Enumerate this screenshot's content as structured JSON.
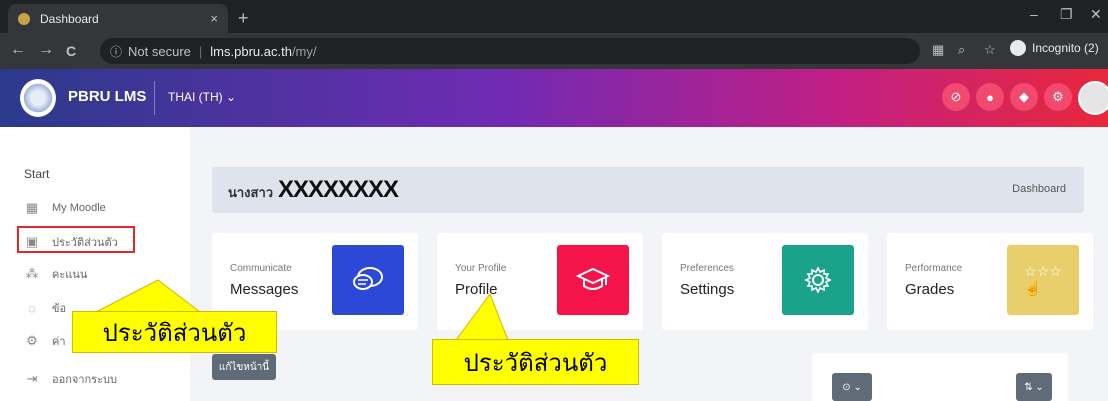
{
  "browser": {
    "tab_title": "Dashboard",
    "tab_close": "×",
    "new_tab": "+",
    "win_min": "–",
    "win_max": "❐",
    "win_close": "✕",
    "back": "←",
    "forward": "→",
    "reload": "C",
    "security_label": "Not secure",
    "url_host": "lms.pbru.ac.th",
    "url_path": "/my/",
    "incognito_label": "Incognito (2)"
  },
  "header": {
    "brand": "PBRU LMS",
    "language": "THAI (TH) ⌄",
    "colors": {
      "accent": "#f24a6e"
    }
  },
  "sidebar": {
    "start": "Start",
    "items": [
      {
        "label": "My Moodle",
        "icon": "dashboard-icon"
      },
      {
        "label": "ประวัติส่วนตัว",
        "icon": "profile-icon"
      },
      {
        "label": "คะแนน",
        "icon": "grades-icon"
      },
      {
        "label": "ข้อ",
        "icon": "messages-icon"
      },
      {
        "label": "ค่า",
        "icon": "settings-icon"
      },
      {
        "label": "ออกจากระบบ",
        "icon": "logout-icon"
      }
    ]
  },
  "page_header": {
    "name": "นางสาว",
    "redacted": "XXXXXXXX",
    "breadcrumb": "Dashboard"
  },
  "cards": [
    {
      "subtitle": "Communicate",
      "title": "Messages",
      "icon": "chat-icon",
      "color": "#2b48d6"
    },
    {
      "subtitle": "Your Profile",
      "title": "Profile",
      "icon": "graduation-cap-icon",
      "color": "#f5144a"
    },
    {
      "subtitle": "Preferences",
      "title": "Settings",
      "icon": "gear-icon",
      "color": "#1aa38a"
    },
    {
      "subtitle": "Performance",
      "title": "Grades",
      "icon": "stars-icon",
      "color": "#e9cf6b"
    }
  ],
  "actions": {
    "edit_page": "แก้ไขหน้านี้",
    "clock_menu": "⊙ ⌄",
    "sort_menu": "⇅ ⌄"
  },
  "callouts": {
    "sidebar_callout": "ประวัติส่วนตัว",
    "card_callout": "ประวัติส่วนตัว"
  }
}
